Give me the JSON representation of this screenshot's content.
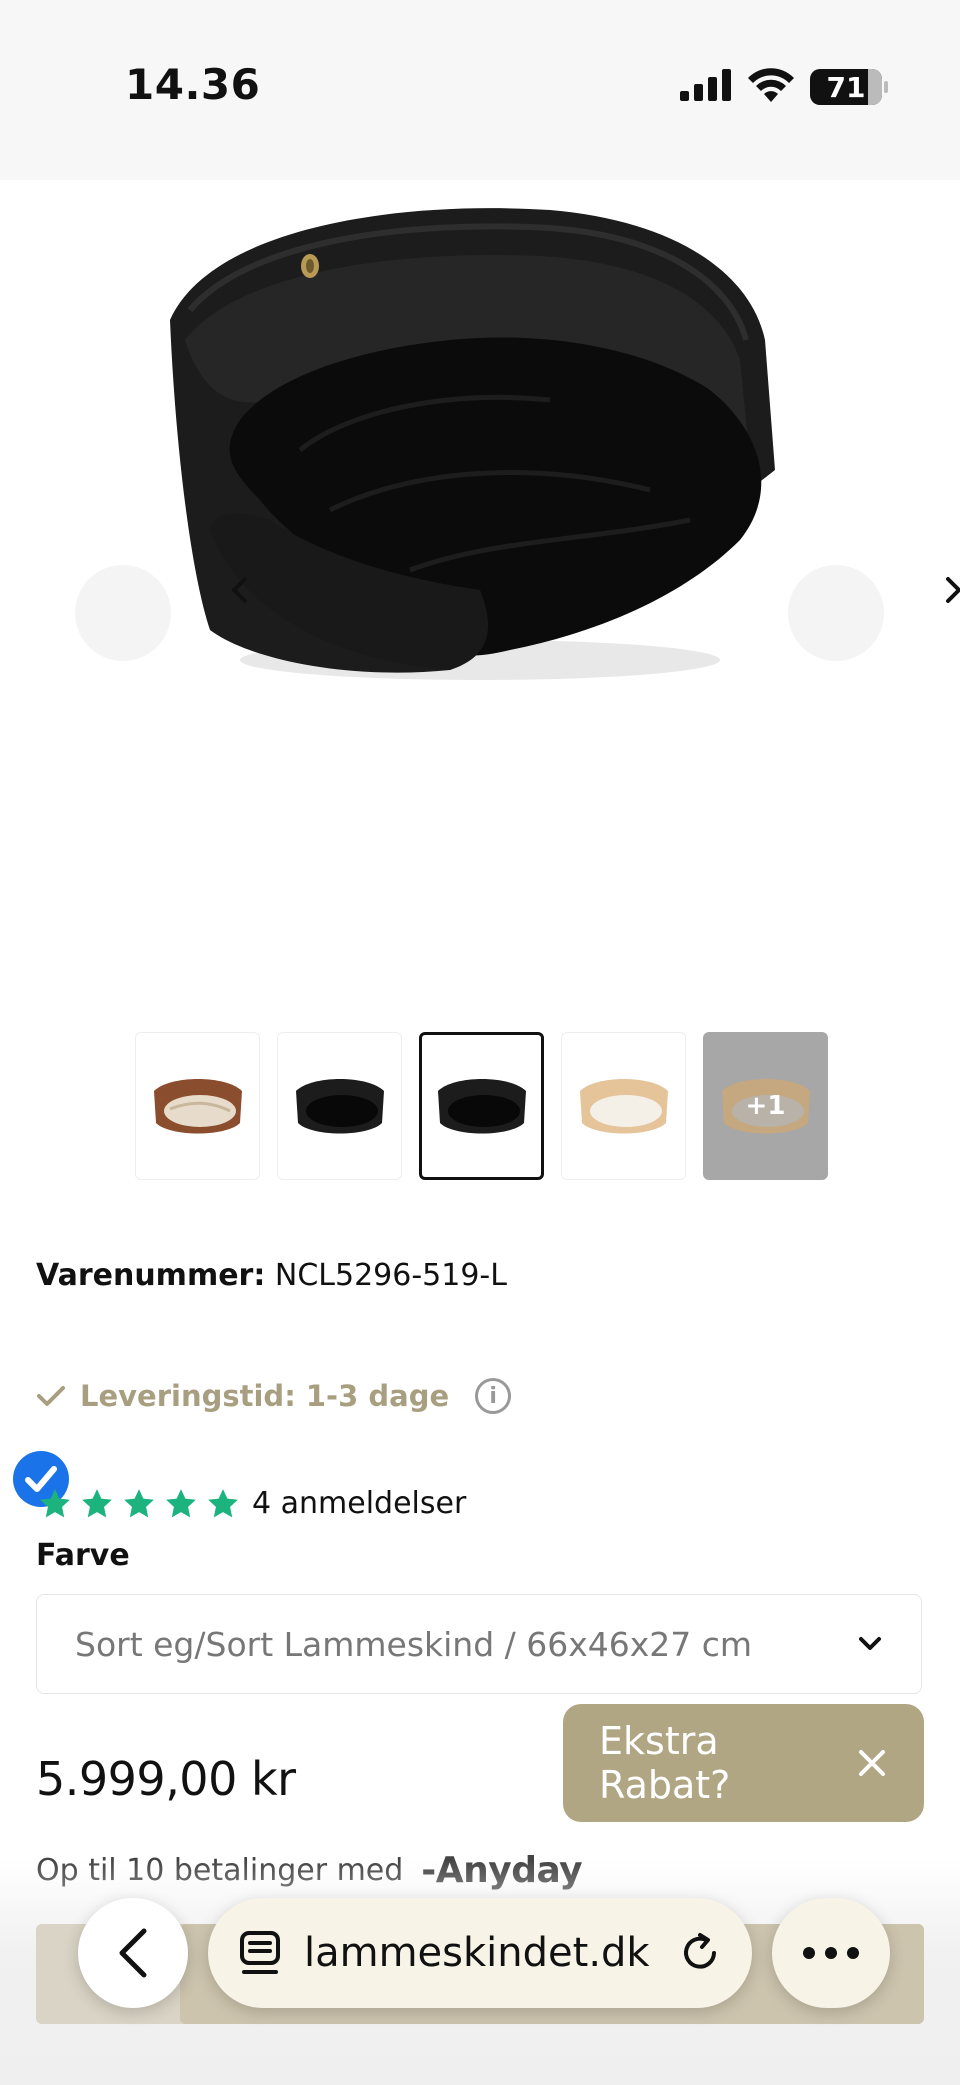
{
  "status_bar": {
    "time": "14.36",
    "battery": "71",
    "icons": [
      "cellular-signal-icon",
      "wifi-icon",
      "battery-icon"
    ]
  },
  "gallery": {
    "thumbnails": [
      {
        "name": "thumb-walnut-beige",
        "active": false
      },
      {
        "name": "thumb-black-black-1",
        "active": false
      },
      {
        "name": "thumb-black-black-2",
        "active": true
      },
      {
        "name": "thumb-oak-white",
        "active": false
      },
      {
        "name": "thumb-more",
        "label": "+1",
        "active": false
      }
    ]
  },
  "product": {
    "sku_label": "Varenummer:",
    "sku_value": "NCL5296-519-L",
    "delivery_text": "Leveringstid: 1-3 dage",
    "rating_stars": 5,
    "review_count_text": "4 anmeldelser",
    "color_label": "Farve",
    "color_selected": "Sort eg/Sort Lammeskind / 66x46x27 cm",
    "price": "5.999,00 kr",
    "installments_text": "Op til 10 betalinger med",
    "installments_brand": "Anyday"
  },
  "promo": {
    "label": "Ekstra Rabat?"
  },
  "browser": {
    "url": "lammeskindet.dk"
  },
  "colors": {
    "accent_gold": "#b1a684",
    "delivery_text": "#a89f80",
    "star_green": "#1db37f",
    "badge_blue": "#1a73e8"
  }
}
